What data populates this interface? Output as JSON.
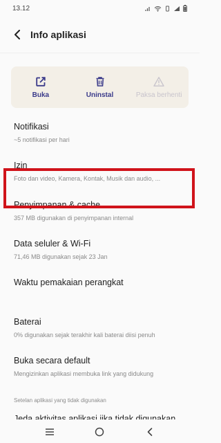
{
  "status_bar": {
    "time": "13.12"
  },
  "header": {
    "title": "Info aplikasi"
  },
  "actions": [
    {
      "label": "Buka",
      "icon": "open-external-icon",
      "enabled": true
    },
    {
      "label": "Uninstal",
      "icon": "trash-icon",
      "enabled": true
    },
    {
      "label": "Paksa berhenti",
      "icon": "warning-icon",
      "enabled": false
    }
  ],
  "items": [
    {
      "title": "Notifikasi",
      "subtitle": "~5 notifikasi per hari"
    },
    {
      "title": "Izin",
      "subtitle": "Foto dan video, Kamera, Kontak, Musik dan audio, ..."
    },
    {
      "title": "Penyimpanan & cache",
      "subtitle": "357 MB digunakan di penyimpanan internal"
    },
    {
      "title": "Data seluler & Wi-Fi",
      "subtitle": "71,46 MB digunakan sejak 23 Jan"
    },
    {
      "title": "Waktu pemakaian perangkat",
      "subtitle": ""
    },
    {
      "title": "Baterai",
      "subtitle": "0% digunakan sejak terakhir kali baterai diisi penuh"
    },
    {
      "title": "Buka secara default",
      "subtitle": "Mengizinkan aplikasi membuka link yang didukung"
    }
  ],
  "section": {
    "label": "Setelan aplikasi yang tidak digunakan"
  },
  "partial_item": {
    "title": "Jeda aktivitas aplikasi jika tidak digunakan"
  },
  "colors": {
    "accent": "#3a3a8a",
    "highlight": "#d0131a",
    "card": "#f3efe7"
  }
}
